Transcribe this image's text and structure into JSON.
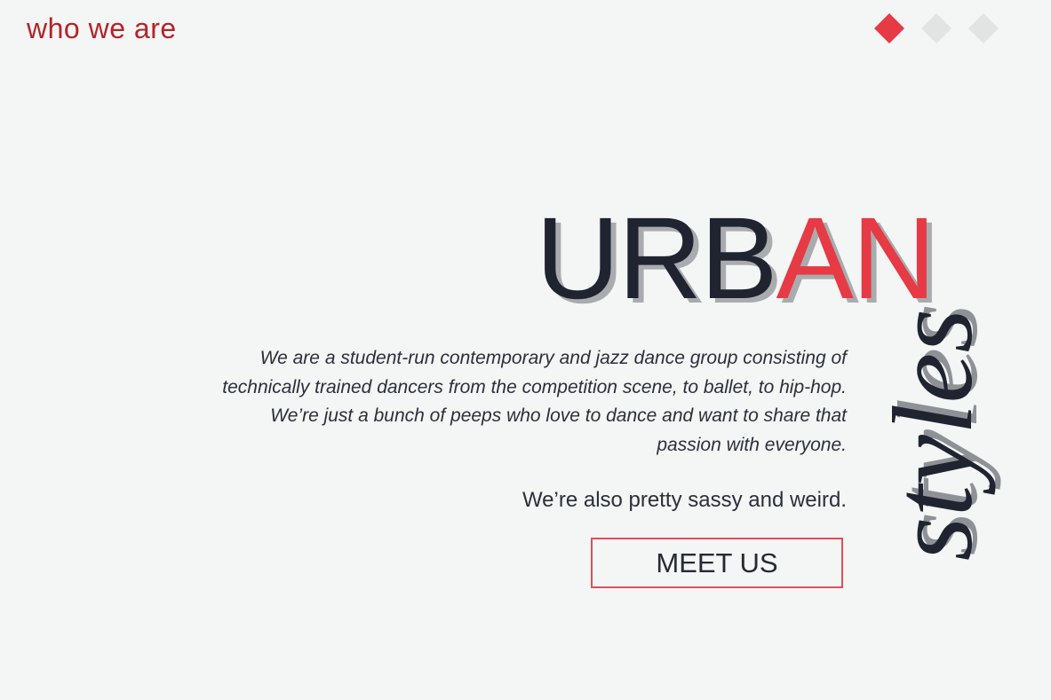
{
  "header": {
    "section_title": "who we are"
  },
  "pager": {
    "count": 3,
    "active_index": 0,
    "colors": {
      "active": "#e63a44",
      "inactive": "#e2e3e3"
    }
  },
  "hero": {
    "title_main": "URB",
    "title_accent": "AN",
    "subtitle": "styles"
  },
  "about": {
    "lines": [
      "We are a student-run contemporary and jazz dance group consisting of",
      "technically trained dancers from the competition scene, to ballet, to hip-hop.",
      "We’re just a bunch of peeps who love to dance and want to share that",
      "passion with everyone."
    ],
    "tagline": "We’re also pretty sassy and weird."
  },
  "cta": {
    "label": "MEET US"
  },
  "colors": {
    "accent": "#e63a44",
    "title_red": "#b0262b",
    "text": "#1f2430",
    "background": "#f4f5f5"
  }
}
